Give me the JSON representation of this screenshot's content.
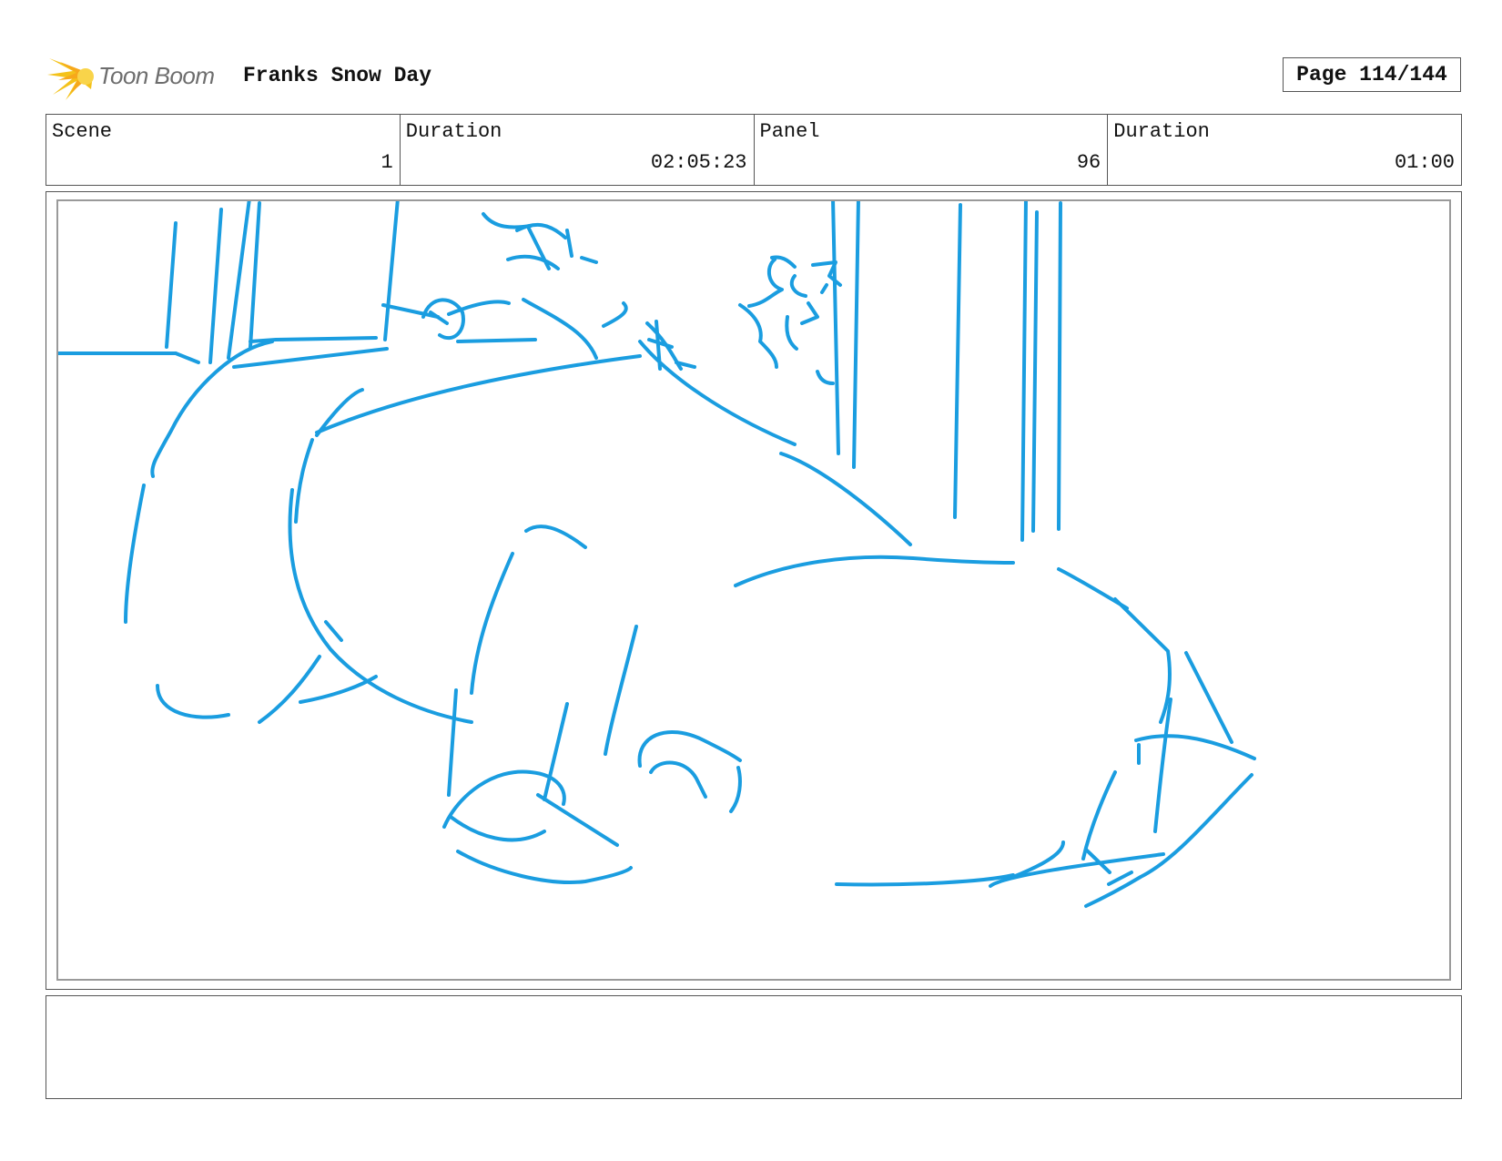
{
  "header": {
    "logo_text": "Toon Boom",
    "project_title": "Franks Snow Day",
    "page_label": "Page 114/144"
  },
  "info": {
    "scene_label": "Scene",
    "scene_value": "1",
    "scene_duration_label": "Duration",
    "scene_duration_value": "02:05:23",
    "panel_label": "Panel",
    "panel_value": "96",
    "panel_duration_label": "Duration",
    "panel_duration_value": "01:00"
  },
  "sketch": {
    "stroke_color": "#1a9de0"
  },
  "notes": {
    "text": ""
  }
}
